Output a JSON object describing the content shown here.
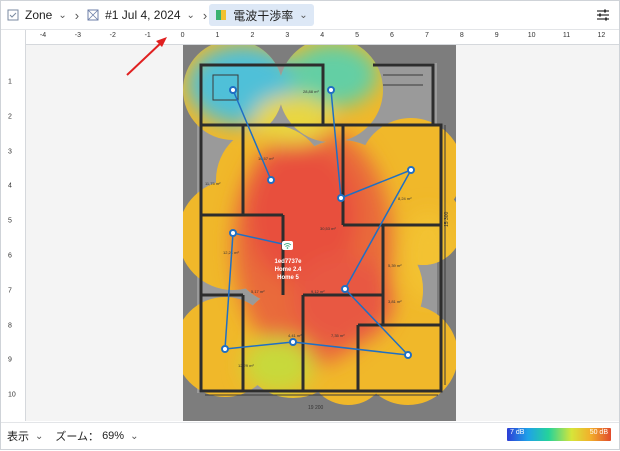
{
  "toolbar": {
    "zone_label": "Zone",
    "snapshot_label": "#1 Jul 4, 2024",
    "layer_label": "電波干渉率"
  },
  "ruler": {
    "x_ticks": [
      "-4",
      "-3",
      "-2",
      "-1",
      "0",
      "1",
      "2",
      "3",
      "4",
      "5",
      "6",
      "7",
      "8",
      "9",
      "10",
      "11",
      "12"
    ],
    "y_ticks": [
      "1",
      "2",
      "3",
      "4",
      "5",
      "6",
      "7",
      "8",
      "9",
      "10"
    ]
  },
  "plan": {
    "device_name": "1ed7737e",
    "device_ssid_1": "Home 2.4",
    "device_ssid_2": "Home 5",
    "dim_bottom": "19 200",
    "dim_right": "15 300",
    "rooms": [
      "30,53 m²",
      "10,57 m²",
      "8,24 m²",
      "11,75 m²",
      "28,88 m²",
      "5,17 m²",
      "9,12 m²",
      "5,39 m²",
      "3,81 m²",
      "4,41 m²",
      "7,35 m²",
      "12,21 m²",
      "12,29 m²"
    ]
  },
  "status": {
    "view_label": "表示",
    "zoom_label": "ズーム：",
    "zoom_value": "69%"
  },
  "legend": {
    "min_label": "7 dB",
    "max_label": "50 dB"
  },
  "colors": {
    "accent": "#1e78d2",
    "active_crumb": "#dde8f6"
  }
}
